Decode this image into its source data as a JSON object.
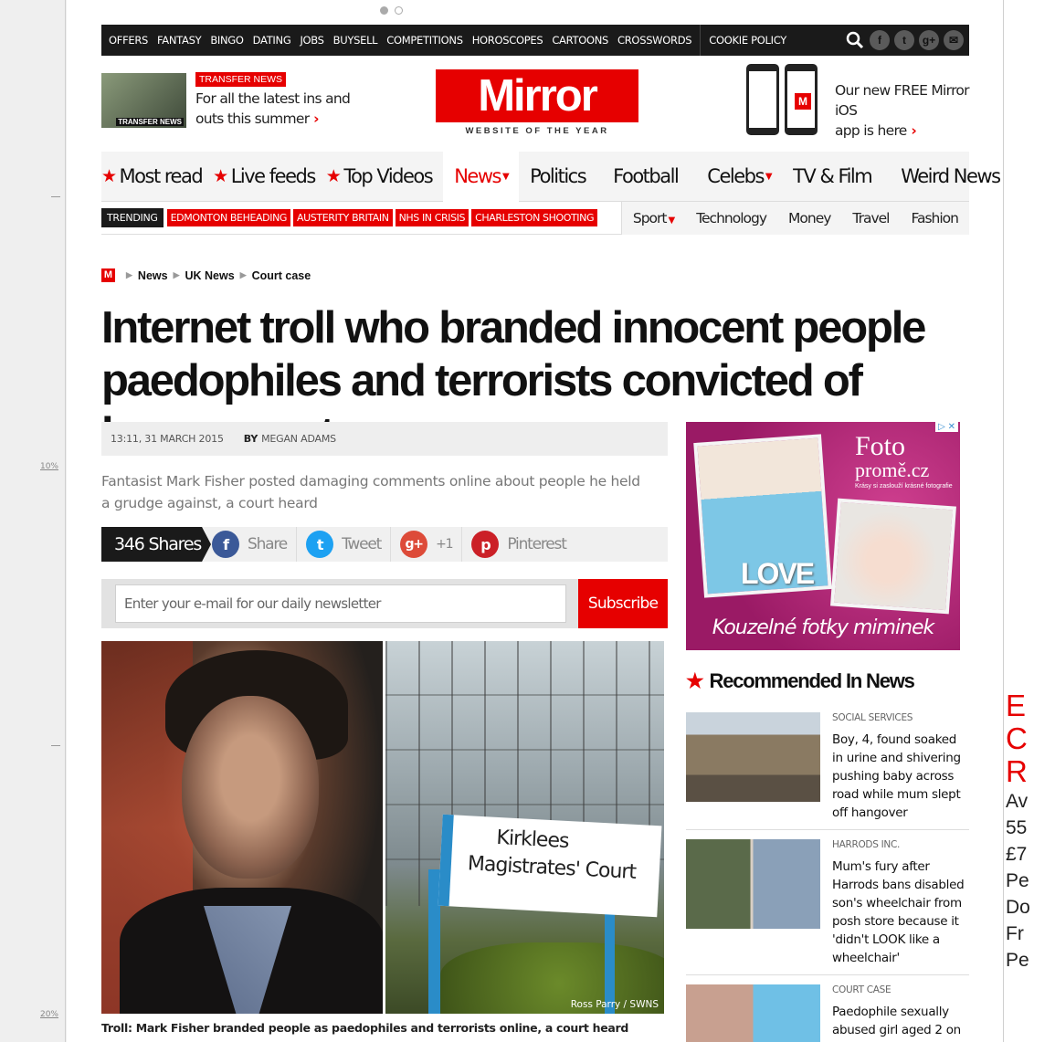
{
  "gutter": {
    "marks": [
      "10%",
      "20%"
    ]
  },
  "topnav": {
    "items": [
      "OFFERS",
      "FANTASY",
      "BINGO",
      "DATING",
      "JOBS",
      "BUYSELL",
      "COMPETITIONS",
      "HOROSCOPES",
      "CARTOONS",
      "CROSSWORDS"
    ],
    "cookie_policy": "COOKIE POLICY",
    "social_icons": [
      "search-icon",
      "facebook-icon",
      "twitter-icon",
      "google-plus-icon",
      "email-icon"
    ]
  },
  "promo_left": {
    "tag": "TRANSFER NEWS",
    "thumb_label": "TRANSFER NEWS",
    "line1": "For all the latest ins and",
    "line2": "outs this summer"
  },
  "logo": {
    "name": "Mirror",
    "tagline": "WEBSITE OF THE YEAR"
  },
  "promo_right": {
    "line1": "Our new FREE Mirror iOS",
    "line2": "app is here"
  },
  "mainnav": {
    "starred": [
      "Most read",
      "Live feeds",
      "Top Videos"
    ],
    "sections": [
      "News",
      "Politics",
      "Football",
      "Celebs",
      "TV & Film",
      "Weird News"
    ]
  },
  "trending": {
    "label": "TRENDING",
    "tags": [
      "EDMONTON BEHEADING",
      "AUSTERITY BRITAIN",
      "NHS IN CRISIS",
      "CHARLESTON SHOOTING"
    ]
  },
  "subnav": [
    "Sport",
    "Technology",
    "Money",
    "Travel",
    "Fashion"
  ],
  "breadcrumb": {
    "icon": "M",
    "items": [
      "News",
      "UK News",
      "Court case"
    ]
  },
  "article": {
    "headline_line1": "Internet troll who branded innocent people",
    "headline_line2": "paedophiles and terrorists convicted of harassment",
    "timestamp": "13:11, 31 MARCH 2015",
    "by_label": "BY",
    "author": "MEGAN ADAMS",
    "standfirst": "Fantasist Mark Fisher posted damaging comments online about people he held a grudge against, a court heard",
    "sign_line1": "Kirklees",
    "sign_line2": "Magistrates' Court",
    "photo_credit": "Ross Parry / SWNS",
    "caption": "Troll: Mark Fisher branded people as paedophiles and terrorists online, a court heard"
  },
  "share": {
    "count": "346 Shares",
    "facebook": "Share",
    "twitter": "Tweet",
    "google": "+1",
    "pinterest": "Pinterest"
  },
  "newsletter": {
    "placeholder": "Enter your e-mail for our daily newsletter",
    "button": "Subscribe"
  },
  "ad": {
    "brand_line1": "Foto",
    "brand_line2": "promě.cz",
    "brand_small": "Krásy si zaslouží krásné fotografie",
    "love": "LOVE",
    "slogan": "Kouzelné fotky miminek"
  },
  "recommended": {
    "title": "Recommended In News",
    "items": [
      {
        "kicker": "SOCIAL SERVICES",
        "text": "Boy, 4, found soaked in urine and shivering pushing baby across road while mum slept off hangover"
      },
      {
        "kicker": "HARRODS INC.",
        "text": "Mum's fury after Harrods bans disabled son's wheelchair from posh store because it 'didn't LOOK like a wheelchair'"
      },
      {
        "kicker": "COURT CASE",
        "text": "Paedophile sexually abused girl aged 2 on"
      }
    ]
  },
  "right_gutter": {
    "red_lines": [
      "E",
      "C",
      "R"
    ],
    "black_lines": [
      "Av",
      "55",
      "£7",
      "Pe",
      "Do",
      "Fr",
      "Pe"
    ]
  },
  "colors": {
    "brand_red": "#e60000",
    "nav_black": "#1a1a1a",
    "facebook": "#3b5998",
    "twitter": "#1da1f2",
    "google": "#dd4b39",
    "pinterest": "#cb2027"
  }
}
